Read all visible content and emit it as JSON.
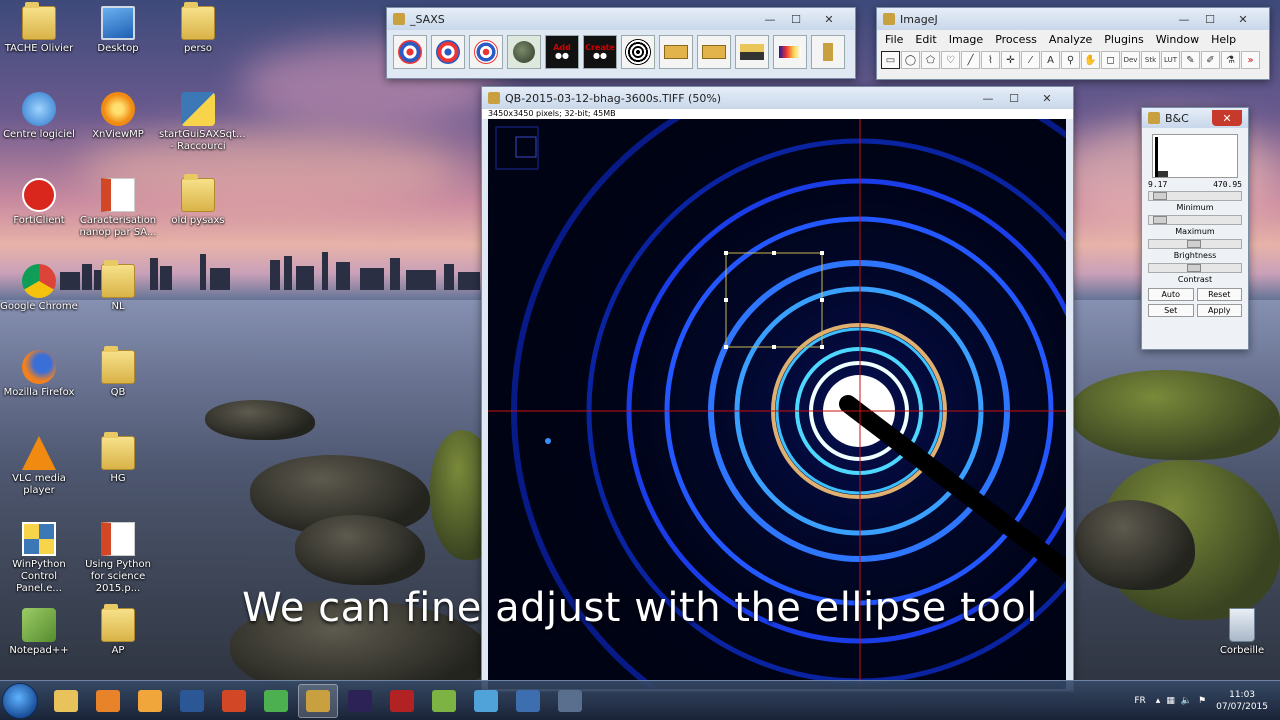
{
  "desktop": {
    "icons": [
      {
        "label": "TACHE Olivier",
        "icon": "user-folder-icon"
      },
      {
        "label": "Desktop",
        "icon": "monitor-icon"
      },
      {
        "label": "perso",
        "icon": "folder-icon"
      },
      {
        "label": "Centre logiciel",
        "icon": "software-center-icon"
      },
      {
        "label": "XnViewMP",
        "icon": "xnview-icon"
      },
      {
        "label": "startGuiSAXSqt... - Raccourci",
        "icon": "python-shortcut-icon"
      },
      {
        "label": "FortiClient",
        "icon": "forticlient-icon"
      },
      {
        "label": "Caracterisation nanop par SA...",
        "icon": "powerpoint-file-icon"
      },
      {
        "label": "old pysaxs",
        "icon": "folder-icon"
      },
      {
        "label": "Google Chrome",
        "icon": "chrome-icon"
      },
      {
        "label": "NL",
        "icon": "folder-icon"
      },
      {
        "label": "Mozilla Firefox",
        "icon": "firefox-icon"
      },
      {
        "label": "QB",
        "icon": "folder-icon"
      },
      {
        "label": "VLC media player",
        "icon": "vlc-icon"
      },
      {
        "label": "HG",
        "icon": "folder-icon"
      },
      {
        "label": "WinPython Control Panel.e...",
        "icon": "winpython-icon"
      },
      {
        "label": "Using Python for science 2015.p...",
        "icon": "powerpoint-file-icon"
      },
      {
        "label": "Notepad++",
        "icon": "notepadpp-icon"
      },
      {
        "label": "AP",
        "icon": "folder-icon"
      },
      {
        "label": "Corbeille",
        "icon": "recycle-bin-icon"
      }
    ]
  },
  "saxs_window": {
    "title": "_SAXS",
    "tools": [
      {
        "label": "",
        "icon": "target-icon"
      },
      {
        "label": "",
        "icon": "target-icon"
      },
      {
        "label": "",
        "icon": "target-icon"
      },
      {
        "label": "",
        "icon": "sphere-icon"
      },
      {
        "label": "Add",
        "icon": "add-mask-icon"
      },
      {
        "label": "Create",
        "icon": "create-mask-icon"
      },
      {
        "label": "",
        "icon": "spiral-icon"
      },
      {
        "label": "",
        "icon": "ruler-icon"
      },
      {
        "label": "",
        "icon": "ruler-icon"
      },
      {
        "label": "",
        "icon": "stack-icon"
      },
      {
        "label": "",
        "icon": "palette-icon"
      },
      {
        "label": "",
        "icon": "imagej-icon"
      }
    ]
  },
  "imagej_window": {
    "title": "ImageJ",
    "menu": [
      "File",
      "Edit",
      "Image",
      "Process",
      "Analyze",
      "Plugins",
      "Window",
      "Help"
    ],
    "tools": [
      {
        "glyph": "▭",
        "icon": "rectangle-tool-icon"
      },
      {
        "glyph": "◯",
        "icon": "oval-tool-icon"
      },
      {
        "glyph": "⬠",
        "icon": "polygon-tool-icon"
      },
      {
        "glyph": "♡",
        "icon": "freehand-tool-icon"
      },
      {
        "glyph": "╱",
        "icon": "line-tool-icon"
      },
      {
        "glyph": "⌇",
        "icon": "angle-tool-icon"
      },
      {
        "glyph": "✛",
        "icon": "point-tool-icon"
      },
      {
        "glyph": "⁄",
        "icon": "wand-tool-icon"
      },
      {
        "glyph": "A",
        "icon": "text-tool-icon"
      },
      {
        "glyph": "⚲",
        "icon": "zoom-tool-icon"
      },
      {
        "glyph": "✋",
        "icon": "hand-tool-icon"
      },
      {
        "glyph": "◻",
        "icon": "dropper-tool-icon"
      },
      {
        "glyph": "Dev",
        "icon": "developer-menu-icon"
      },
      {
        "glyph": "Stk",
        "icon": "stack-menu-icon"
      },
      {
        "glyph": "LUT",
        "icon": "lut-menu-icon"
      },
      {
        "glyph": "✎",
        "icon": "pencil-tool-icon"
      },
      {
        "glyph": "✐",
        "icon": "brush-tool-icon"
      },
      {
        "glyph": "⚗",
        "icon": "flood-fill-tool-icon"
      },
      {
        "glyph": "»",
        "icon": "more-tools-icon"
      }
    ]
  },
  "image_window": {
    "title": "QB-2015-03-12-bhag-3600s.TIFF (50%)",
    "info": "3450x3450 pixels; 32-bit; 45MB"
  },
  "bc_window": {
    "title": "B&C",
    "min_value": "9.17",
    "max_value": "470.95",
    "minimum_label": "Minimum",
    "maximum_label": "Maximum",
    "brightness_label": "Brightness",
    "contrast_label": "Contrast",
    "auto_label": "Auto",
    "reset_label": "Reset",
    "set_label": "Set",
    "apply_label": "Apply"
  },
  "caption": "We can fine adjust with the ellipse tool",
  "taskbar": {
    "apps": [
      {
        "icon": "explorer-icon",
        "color": "#e8c25a"
      },
      {
        "icon": "media-player-icon",
        "color": "#e8832a"
      },
      {
        "icon": "outlook-icon",
        "color": "#f0a63a"
      },
      {
        "icon": "word-icon",
        "color": "#2b5797"
      },
      {
        "icon": "powerpoint-icon",
        "color": "#d24726"
      },
      {
        "icon": "chrome-icon",
        "color": "#4caf50"
      },
      {
        "icon": "imagej-icon",
        "color": "#c8a040"
      },
      {
        "icon": "eclipse-icon",
        "color": "#2c2255"
      },
      {
        "icon": "spider-icon",
        "color": "#b22222"
      },
      {
        "icon": "notepadpp-icon",
        "color": "#7cb342"
      },
      {
        "icon": "blue-app-icon",
        "color": "#4fa3d8"
      },
      {
        "icon": "fast-forward-icon",
        "color": "#3d6fb0"
      },
      {
        "icon": "video-app-icon",
        "color": "#5a6f8e"
      }
    ],
    "lang": "FR",
    "time": "11:03",
    "date": "07/07/2015"
  }
}
